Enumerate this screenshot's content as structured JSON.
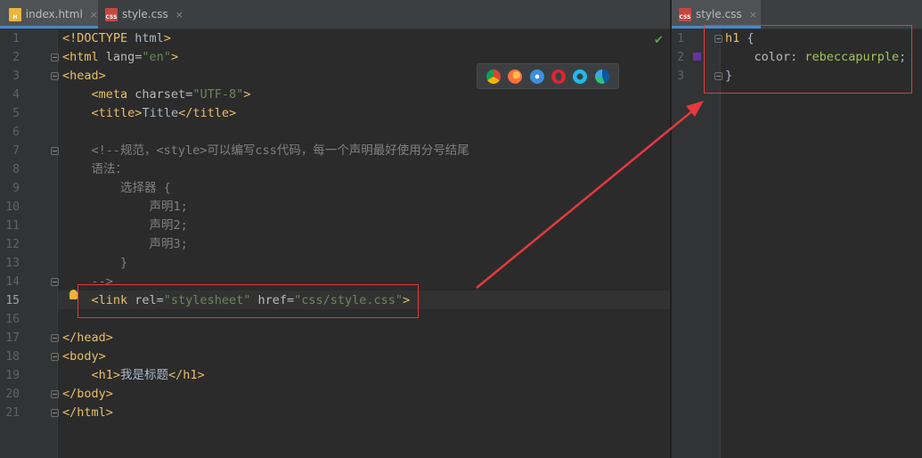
{
  "left_pane": {
    "tabs": [
      {
        "label": "index.html",
        "icon": "html-file-icon",
        "active": true
      },
      {
        "label": "style.css",
        "icon": "css-file-icon",
        "active": false
      }
    ],
    "line_numbers": [
      "1",
      "2",
      "3",
      "4",
      "5",
      "6",
      "7",
      "8",
      "9",
      "10",
      "11",
      "12",
      "13",
      "14",
      "15",
      "16",
      "17",
      "18",
      "19",
      "20",
      "21"
    ],
    "current_line": "15",
    "lines": [
      "<!DOCTYPE html>",
      "<html lang=\"en\">",
      "<head>",
      "    <meta charset=\"UTF-8\">",
      "    <title>Title</title>",
      "",
      "    <!--规范，<style>可以编写css代码，每一个声明最好使用分号结尾",
      "    语法：",
      "        选择器 {",
      "            声明1;",
      "            声明2;",
      "            声明3;",
      "        }",
      "    -->",
      "    <link rel=\"stylesheet\" href=\"css/style.css\">",
      "",
      "</head>",
      "<body>",
      "    <h1>我是标题</h1>",
      "</body>",
      "</html>"
    ],
    "browser_icons": [
      "chrome-icon",
      "firefox-icon",
      "safari-icon",
      "opera-icon",
      "ie-icon",
      "edge-icon"
    ]
  },
  "right_pane": {
    "tabs": [
      {
        "label": "style.css",
        "icon": "css-file-icon",
        "active": true
      }
    ],
    "line_numbers": [
      "1",
      "2",
      "3"
    ],
    "lines": [
      "h1 {",
      "    color: rebeccapurple;",
      "}"
    ],
    "swatch_color": "#663399"
  },
  "icon_text": {
    "html": "H",
    "css": "CSS"
  },
  "close_glyph": "×",
  "check_glyph": "✔",
  "colors": {
    "background": "#2b2b2b",
    "tag": "#e8bf6a",
    "string": "#6a8759",
    "comment": "#808080",
    "annotation": "#e5393c"
  }
}
